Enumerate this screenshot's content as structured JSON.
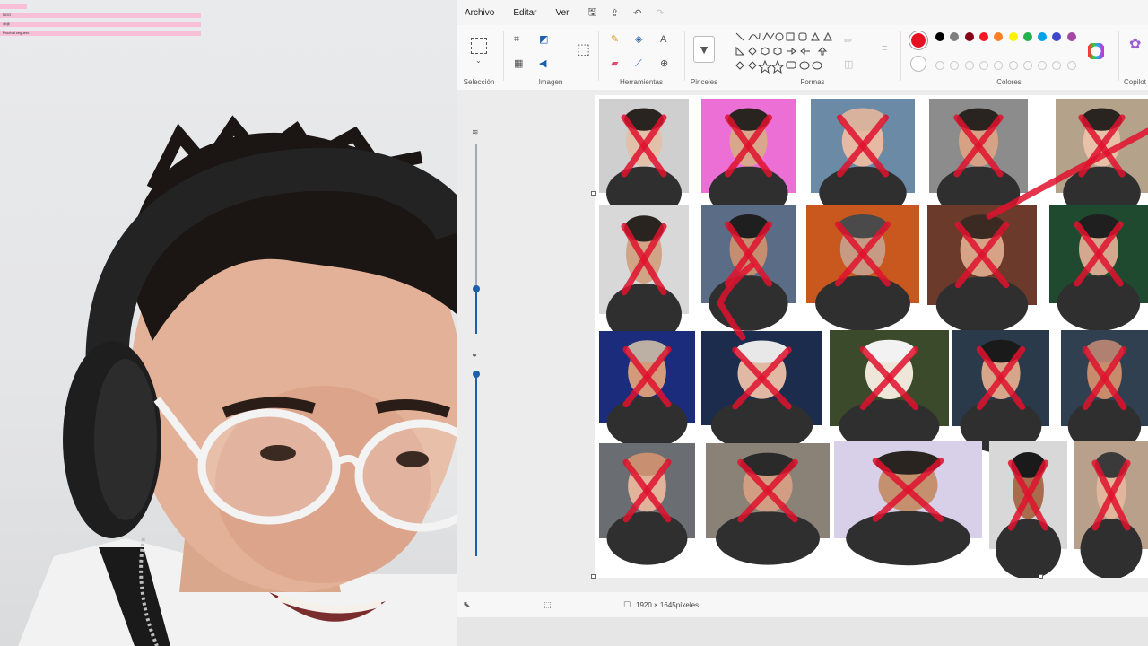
{
  "chat_overlay": {
    "lines": [
      "",
      "NOO",
      "@@",
      "Prochat ceguero"
    ]
  },
  "menubar": {
    "items": [
      "Archivo",
      "Editar",
      "Ver"
    ],
    "quick_actions": [
      {
        "name": "save-icon",
        "glyph": "🖫"
      },
      {
        "name": "share-icon",
        "glyph": "⇪"
      },
      {
        "name": "undo-icon",
        "glyph": "↶"
      },
      {
        "name": "redo-icon",
        "glyph": "↷"
      }
    ]
  },
  "ribbon": {
    "groups": {
      "selection": "Selección",
      "image": "Imagen",
      "tools": "Herramientas",
      "brushes": "Pinceles",
      "shapes": "Formas",
      "colors": "Colores",
      "copilot": "Copilot"
    },
    "active_color": "#e81123",
    "palette_row1": [
      "#000000",
      "#7f7f7f",
      "#880015",
      "#ed1c24",
      "#ff7f27",
      "#fff200",
      "#22b14c",
      "#00a2e8",
      "#3f48cc",
      "#a349a4"
    ],
    "palette_row2": [
      "#ffffff",
      "#c3c3c3",
      "#b97a57",
      "#ffaec9",
      "#ffc90e",
      "#efe4b0",
      "#b5e61d",
      "#99d9ea",
      "#7092be",
      "#c8bfe7"
    ]
  },
  "statusbar": {
    "dimensions": "1920 × 1645píxeles"
  },
  "canvas": {
    "cross_color": "#e0122e"
  }
}
